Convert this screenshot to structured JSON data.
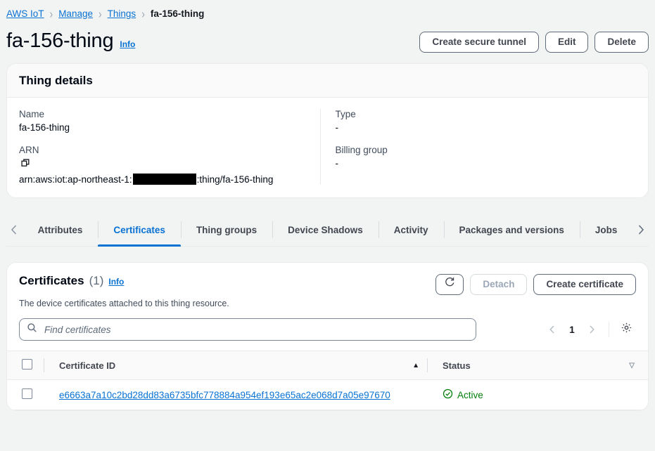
{
  "breadcrumb": {
    "items": [
      {
        "label": "AWS IoT",
        "link": true
      },
      {
        "label": "Manage",
        "link": true
      },
      {
        "label": "Things",
        "link": true
      },
      {
        "label": "fa-156-thing",
        "link": false
      }
    ],
    "separator": "›"
  },
  "header": {
    "title": "fa-156-thing",
    "info_label": "Info",
    "buttons": [
      {
        "label": "Create secure tunnel",
        "disabled": false
      },
      {
        "label": "Edit",
        "disabled": false
      },
      {
        "label": "Delete",
        "disabled": false
      }
    ]
  },
  "thing_details": {
    "card_title": "Thing details",
    "left": [
      {
        "label": "Name",
        "value": "fa-156-thing"
      },
      {
        "label": "ARN",
        "value_prefix": "arn:aws:iot:ap-northeast-1:",
        "value_suffix": ":thing/fa-156-thing",
        "redacted": true,
        "copy_icon": "copy-icon"
      }
    ],
    "right": [
      {
        "label": "Type",
        "value": "-"
      },
      {
        "label": "Billing group",
        "value": "-"
      }
    ]
  },
  "tabs": {
    "prev_icon": "chevron-left-icon",
    "next_icon": "chevron-right-icon",
    "items": [
      {
        "label": "Attributes",
        "active": false
      },
      {
        "label": "Certificates",
        "active": true
      },
      {
        "label": "Thing groups",
        "active": false
      },
      {
        "label": "Device Shadows",
        "active": false
      },
      {
        "label": "Activity",
        "active": false
      },
      {
        "label": "Packages and versions",
        "active": false
      },
      {
        "label": "Jobs",
        "active": false
      }
    ]
  },
  "certificates": {
    "title": "Certificates",
    "count": "(1)",
    "info_label": "Info",
    "description": "The device certificates attached to this thing resource.",
    "refresh_icon": "refresh-icon",
    "detach_label": "Detach",
    "detach_disabled": true,
    "create_label": "Create certificate",
    "search": {
      "placeholder": "Find certificates",
      "value": "",
      "icon": "search-icon"
    },
    "pagination": {
      "prev_icon": "chevron-left-icon",
      "page": "1",
      "next_icon": "chevron-right-icon",
      "settings_icon": "gear-icon"
    },
    "table": {
      "columns": [
        {
          "label": "Certificate ID",
          "sort": "asc"
        },
        {
          "label": "Status",
          "sort": "none"
        }
      ],
      "rows": [
        {
          "certificate_id": "e6663a7a10c2bd28dd83a6735bfc778884a954ef193e65ac2e068d7a05e97670",
          "status": "Active",
          "status_icon": "status-success-icon",
          "selected": false
        }
      ]
    }
  },
  "colors": {
    "link": "#0972d3",
    "success": "#037f0c",
    "page_bg": "#f2f3f3",
    "card_bg": "#ffffff",
    "header_bg": "#fafafa",
    "border": "#e9ebed"
  }
}
